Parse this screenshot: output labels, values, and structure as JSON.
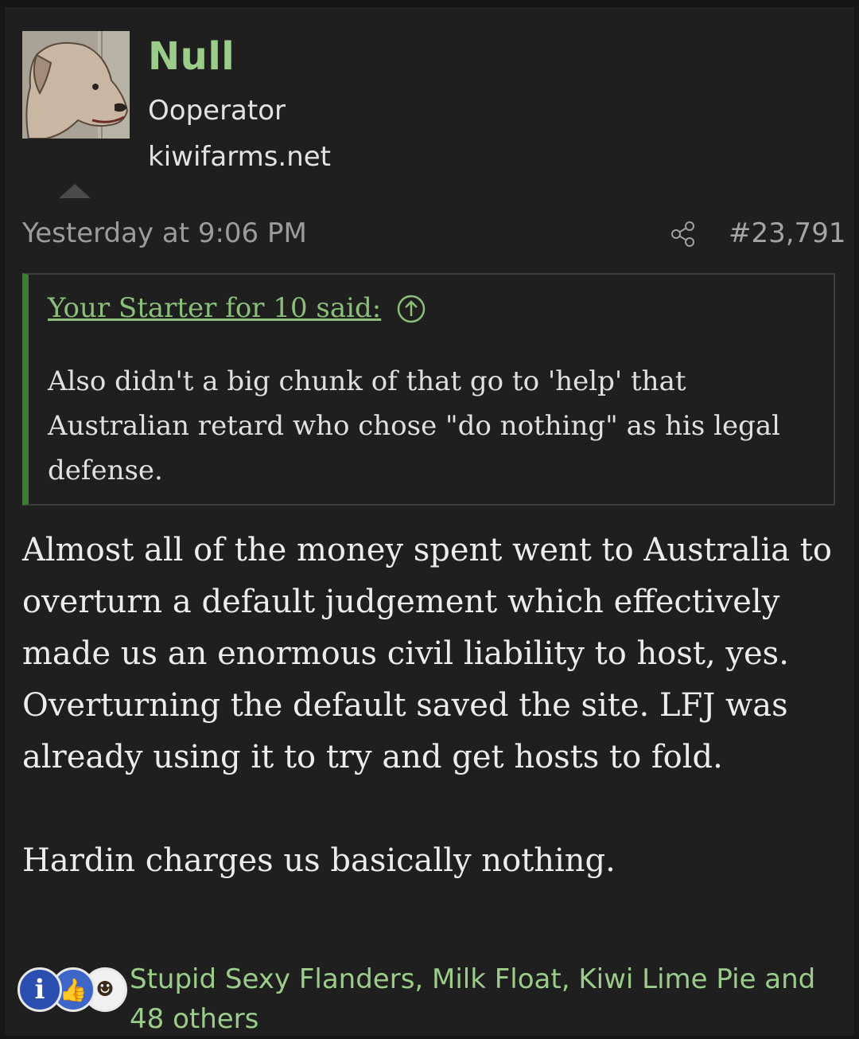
{
  "author": {
    "name": "Null",
    "title": "Ooperator",
    "banner": "kiwifarms.net"
  },
  "post": {
    "date": "Yesterday at 9:06 PM",
    "number": "#23,791"
  },
  "quote": {
    "attribution": "Your Starter for 10 said:",
    "text": "Also didn't a big chunk of that go to 'help' that Australian retard who chose \"do nothing\" as his legal defense."
  },
  "message": {
    "paragraph1": "Almost all of the money spent went to Australia to overturn a default judgement which effectively made us an enormous civil liability to host, yes. Overturning the default saved the site. LFJ was already using it to try and get hosts to fold.",
    "paragraph2": "Hardin charges us basically nothing."
  },
  "reactions": {
    "icons": [
      "informative-icon",
      "like-icon",
      "dumb-icon"
    ],
    "summary": "Stupid Sexy Flanders, Milk Float, Kiwi Lime Pie and 48 others"
  },
  "colors": {
    "background": "#1f1f1f",
    "username": "#9ccc8a",
    "quote_border": "#3f7a35",
    "link": "#8bbf7a"
  }
}
